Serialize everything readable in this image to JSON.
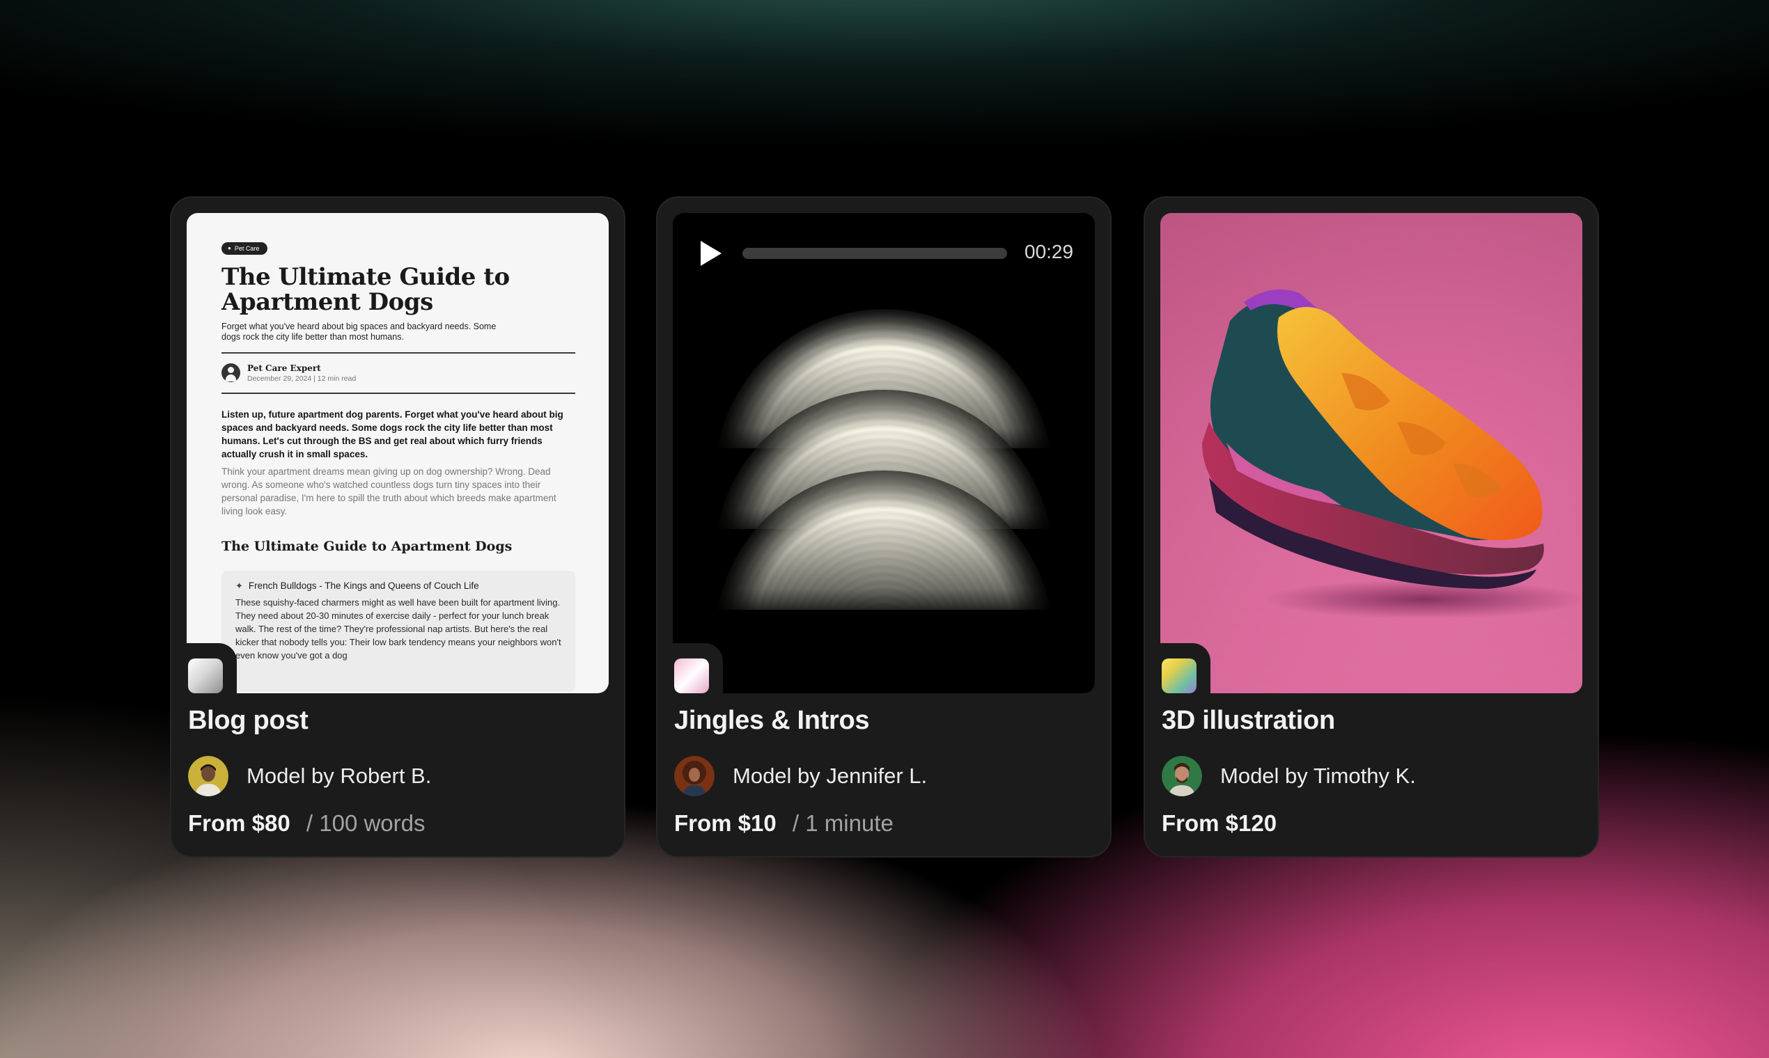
{
  "cards": [
    {
      "title": "Blog post",
      "author": "Model by Robert B.",
      "price": "From $80",
      "unit": "/ 100 words"
    },
    {
      "title": "Jingles & Intros",
      "author": "Model by Jennifer L.",
      "price": "From $10",
      "unit": "/ 1 minute"
    },
    {
      "title": "3D illustration",
      "author": "Model by Timothy K.",
      "price": "From $120",
      "unit": ""
    }
  ],
  "blog_preview": {
    "tag": "Pet Care",
    "title": "The Ultimate Guide to Apartment Dogs",
    "subtitle": "Forget what you've heard about big spaces and backyard needs. Some dogs rock the city life better than most humans.",
    "author": "Pet Care Expert",
    "meta": "December 29, 2024 |  12 min read",
    "lead": "Listen up, future apartment dog parents. Forget what you've heard about big spaces and backyard needs. Some dogs rock the city life better than most humans. Let's cut through the BS and get real about which furry friends actually crush it in small spaces.",
    "body": "Think your apartment dreams mean giving up on dog ownership? Wrong. Dead wrong. As someone who's watched countless dogs turn tiny spaces into their personal paradise, I'm here to spill the truth about which breeds make apartment living look easy.",
    "section_title": "The Ultimate Guide to Apartment Dogs",
    "box_title": "French Bulldogs - The Kings and Queens of Couch Life",
    "box_body": "These squishy-faced charmers might as well have been built for apartment living. They need about 20-30 minutes of exercise daily - perfect for your lunch break walk. The rest of the time? They're professional nap artists. But here's the real kicker that nobody tells you: Their low bark tendency means your neighbors won't even know you've got a dog"
  },
  "audio_preview": {
    "time": "00:29",
    "progress": 0
  },
  "icons": [
    "play-icon",
    "paw-icon",
    "dog-icon",
    "user-icon"
  ],
  "colors": {
    "card_bg": "#1b1b1b",
    "shoe_bg": "#e06a9e",
    "price_unit": "#a3a3a3"
  }
}
